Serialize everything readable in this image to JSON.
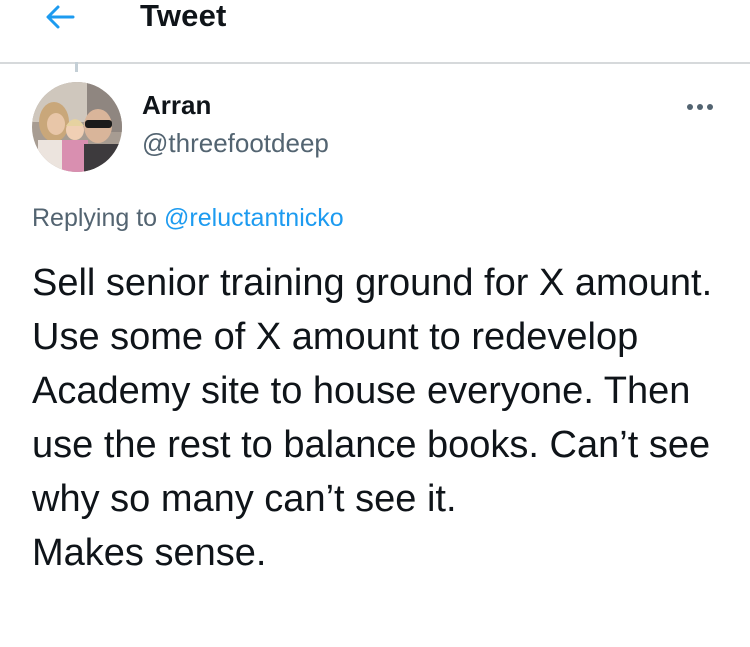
{
  "header": {
    "title": "Tweet",
    "back_icon": "arrow-left-icon",
    "accent_color": "#1d9bf0"
  },
  "tweet": {
    "author": {
      "display_name": "Arran",
      "handle": "@threefootdeep",
      "avatar_icon": "profile-photo"
    },
    "more_icon": "ellipsis-icon",
    "reply_context": {
      "prefix": "Replying to ",
      "handle": "@reluctantnicko"
    },
    "text": "Sell senior training ground for X amount. Use some of X amount to redevelop Academy site to house everyone. Then use the rest to balance books. Can’t see why so many can’t see it.\nMakes sense."
  }
}
